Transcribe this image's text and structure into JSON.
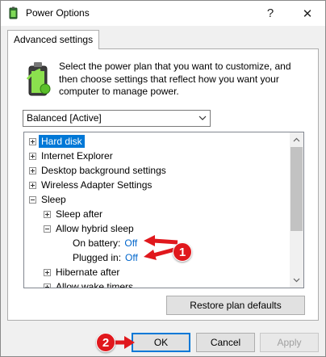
{
  "window": {
    "title": "Power Options",
    "help_glyph": "?",
    "close_glyph": "✕"
  },
  "tab": {
    "label": "Advanced settings"
  },
  "description": "Select the power plan that you want to customize, and then choose settings that reflect how you want your computer to manage power.",
  "plan_select": {
    "value": "Balanced [Active]"
  },
  "tree": {
    "items": [
      {
        "label": "Hard disk",
        "expander": "plus",
        "selected": true
      },
      {
        "label": "Internet Explorer",
        "expander": "plus"
      },
      {
        "label": "Desktop background settings",
        "expander": "plus"
      },
      {
        "label": "Wireless Adapter Settings",
        "expander": "plus"
      },
      {
        "label": "Sleep",
        "expander": "minus"
      },
      {
        "label": "Sleep after",
        "expander": "plus"
      },
      {
        "label": "Allow hybrid sleep",
        "expander": "minus"
      },
      {
        "label": "On battery:",
        "value": "Off"
      },
      {
        "label": "Plugged in:",
        "value": "Off"
      },
      {
        "label": "Hibernate after",
        "expander": "plus"
      },
      {
        "label": "Allow wake timers",
        "expander": "plus"
      }
    ]
  },
  "buttons": {
    "restore": "Restore plan defaults",
    "ok": "OK",
    "cancel": "Cancel",
    "apply": "Apply"
  },
  "callouts": {
    "first": "1",
    "second": "2"
  },
  "colors": {
    "selection": "#0078d7",
    "value_link": "#0066cc",
    "callout_red": "#e0181d"
  }
}
